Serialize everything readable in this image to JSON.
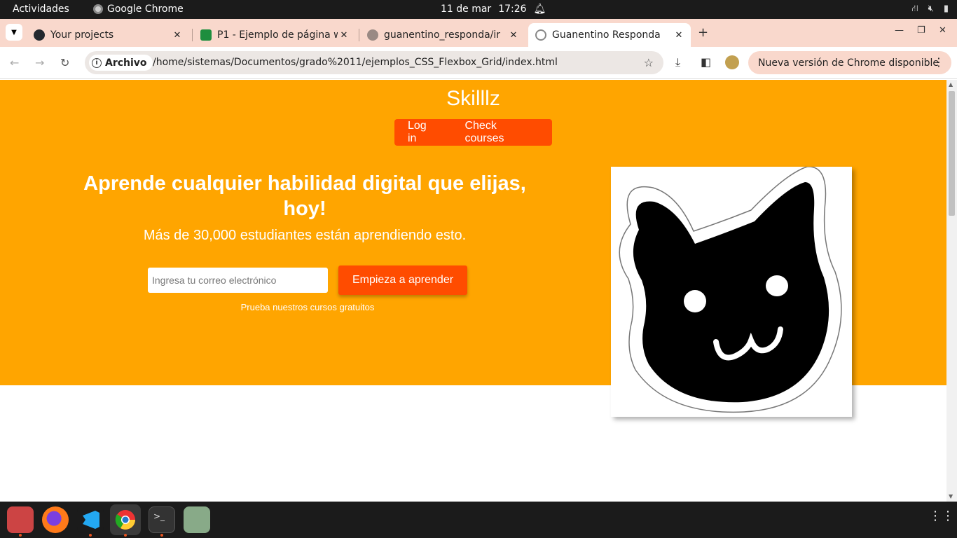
{
  "system": {
    "activities": "Actividades",
    "app_name": "Google Chrome",
    "date": "11 de mar",
    "time": "17:26"
  },
  "tabs": [
    {
      "title": "Your projects",
      "icon": "github-icon"
    },
    {
      "title": "P1 - Ejemplo de página w",
      "icon": "classroom-icon"
    },
    {
      "title": "guanentino_responda/ir",
      "icon": "github-icon"
    },
    {
      "title": "Guanentino Responda",
      "icon": "globe-icon",
      "active": true
    }
  ],
  "toolbar": {
    "security_chip": "Archivo",
    "url": "/home/sistemas/Documentos/grado%2011/ejemplos_CSS_Flexbox_Grid/index.html",
    "update_label": "Nueva versión de Chrome disponible"
  },
  "page": {
    "brand": "Skilllz",
    "nav": [
      "Log in",
      "Check courses"
    ],
    "headline": "Aprende cualquier habilidad digital que elijas, hoy!",
    "subheadline": "Más de 30,000 estudiantes están aprendiendo esto.",
    "email_placeholder": "Ingresa tu correo electrónico",
    "cta_label": "Empieza a aprender",
    "free_courses": "Prueba nuestros cursos gratuitos",
    "hero_color": "#ffa500",
    "accent_color": "#ff4c00"
  },
  "dock": [
    "files-icon",
    "firefox-icon",
    "vscode-icon",
    "chrome-icon",
    "terminal-icon",
    "trash-icon"
  ]
}
